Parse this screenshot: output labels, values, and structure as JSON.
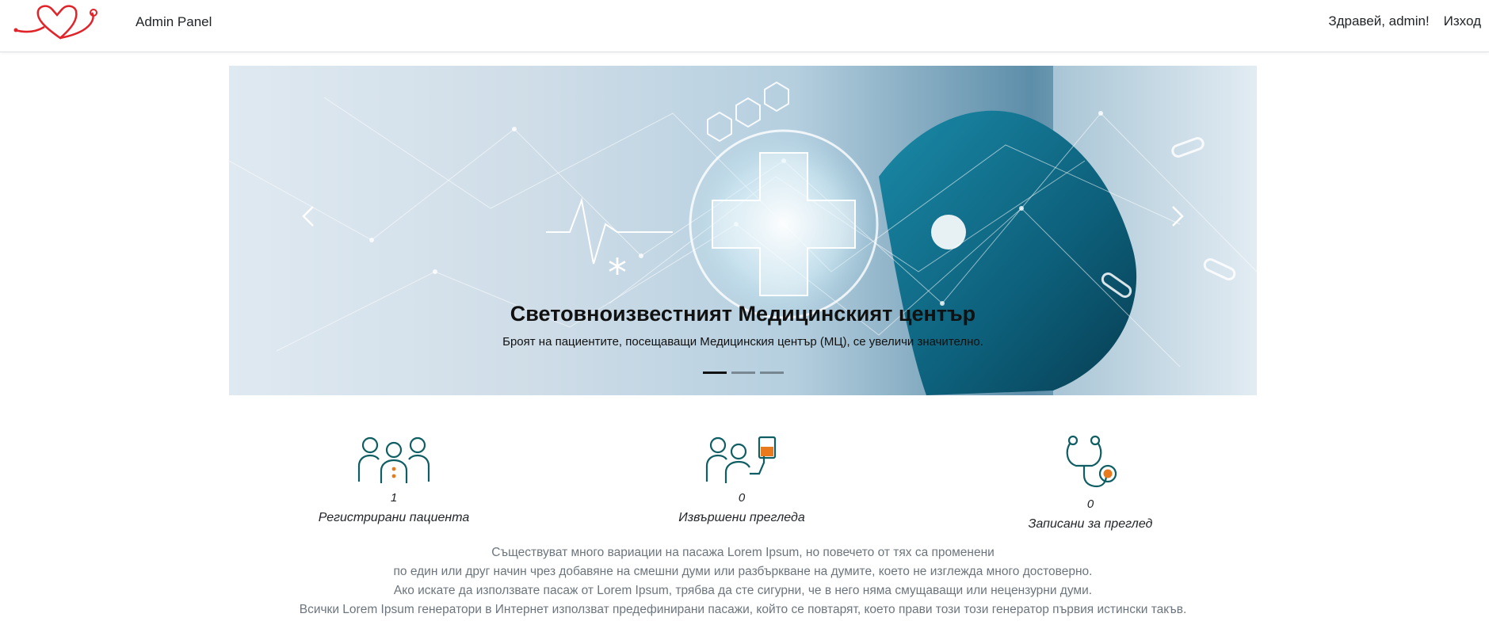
{
  "navbar": {
    "brand": "Admin Panel",
    "greeting": "Здравей, admin!",
    "logout": "Изход"
  },
  "carousel": {
    "title": "Световноизвестният Медицинският център",
    "text": "Броят на пациентите, посещаващи Медицинския център (МЦ), се увеличи значително.",
    "slides_count": 3,
    "active_slide": 1
  },
  "stats": [
    {
      "icon": "patients-icon",
      "value": "1",
      "label": "Регистрирани пациента"
    },
    {
      "icon": "patient-iv-icon",
      "value": "0",
      "label": "Извършени прегледа"
    },
    {
      "icon": "stethoscope-icon",
      "value": "0",
      "label": "Записани за преглед"
    }
  ],
  "body_text": [
    "Съществуват много вариации на пасажа Lorem Ipsum, но повечето от тях са променени",
    "по един или друг начин чрез добавяне на смешни думи или разбъркване на думите, което не изглежда много достоверно.",
    "Ако искате да използвате пасаж от Lorem Ipsum, трябва да сте сигурни, че в него няма смущаващи или нецензурни думи.",
    "Всички Lorem Ipsum генератори в Интернет използват предефинирани пасажи, който се повтарят, което прави този този генератор първия истински такъв."
  ],
  "colors": {
    "accent_teal": "#0f5e63",
    "accent_orange": "#e8791c",
    "logo_red": "#e0242a"
  }
}
